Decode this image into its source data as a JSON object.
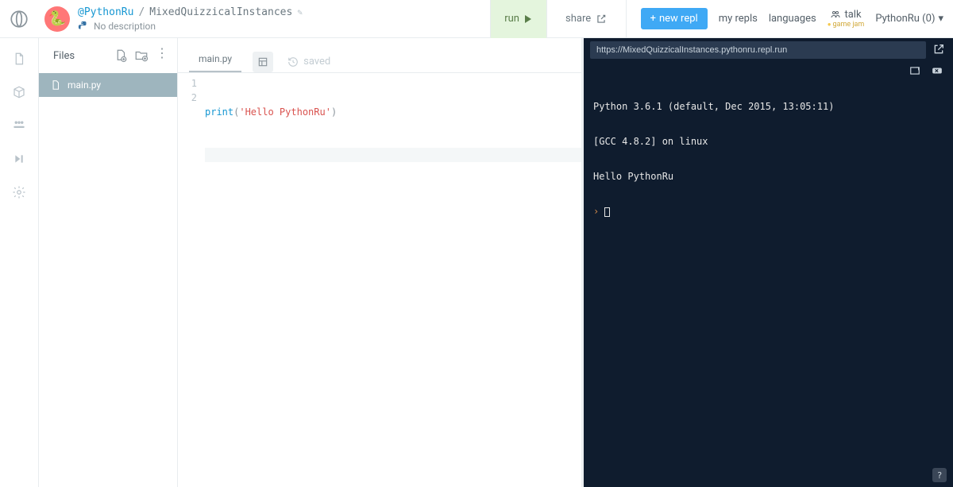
{
  "header": {
    "user": "@PythonRu",
    "separator": "/",
    "project": "MixedQuizzicalInstances",
    "description": "No description",
    "run_label": "run",
    "share_label": "share",
    "new_repl_label": "new repl",
    "nav": {
      "my_repls": "my repls",
      "languages": "languages",
      "talk": "talk",
      "talk_sub": "game jam"
    },
    "user_menu": "PythonRu (0)"
  },
  "sidebar": {
    "icons": [
      "file-outline-icon",
      "cube-icon",
      "group-icon",
      "step-forward-icon",
      "gear-icon"
    ]
  },
  "files": {
    "title": "Files",
    "actions": [
      "new-file-icon",
      "new-folder-icon",
      "more-icon"
    ],
    "items": [
      {
        "name": "main.py",
        "selected": true
      }
    ]
  },
  "editor": {
    "tab_label": "main.py",
    "saved_label": "saved",
    "lines": [
      {
        "n": "1",
        "fn": "print",
        "open": "(",
        "str": "'Hello PythonRu'",
        "close": ")"
      },
      {
        "n": "2"
      }
    ]
  },
  "console": {
    "url": "https://MixedQuizzicalInstances.pythonru.repl.run",
    "lines": [
      "Python 3.6.1 (default, Dec 2015, 13:05:11)",
      "[GCC 4.8.2] on linux",
      "Hello PythonRu"
    ],
    "prompt": "›"
  }
}
